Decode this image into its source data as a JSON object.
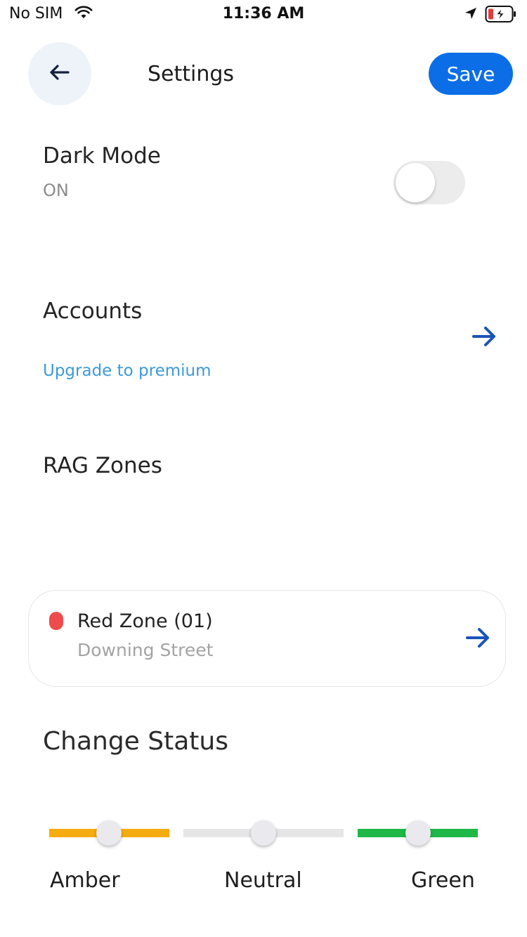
{
  "status_bar": {
    "carrier": "No SIM",
    "time": "11:36 AM",
    "wifi_icon": "wifi-icon",
    "location_icon": "location-arrow-icon",
    "battery_icon": "battery-charging-icon",
    "battery_level_percent": 15
  },
  "header": {
    "back_icon": "arrow-left-icon",
    "title": "Settings",
    "save_label": "Save"
  },
  "dark_mode": {
    "title": "Dark Mode",
    "value": "ON",
    "toggle_on": false
  },
  "accounts": {
    "title": "Accounts",
    "upgrade_link": "Upgrade to premium",
    "arrow_icon": "arrow-right-icon"
  },
  "rag_zones": {
    "title": "RAG Zones",
    "zone": {
      "name": "Red Zone (01)",
      "location": "Downing Street",
      "status_color": "#f04b4b"
    }
  },
  "change_status": {
    "title": "Change Status",
    "options": [
      {
        "label": "Amber",
        "color": "#f5ac10"
      },
      {
        "label": "Neutral",
        "color": "#e6e6e6"
      },
      {
        "label": "Green",
        "color": "#1fb748"
      }
    ]
  },
  "colors": {
    "accent": "#0c6ee6",
    "link": "#3d9ad8",
    "arrow": "#1a54b8"
  }
}
